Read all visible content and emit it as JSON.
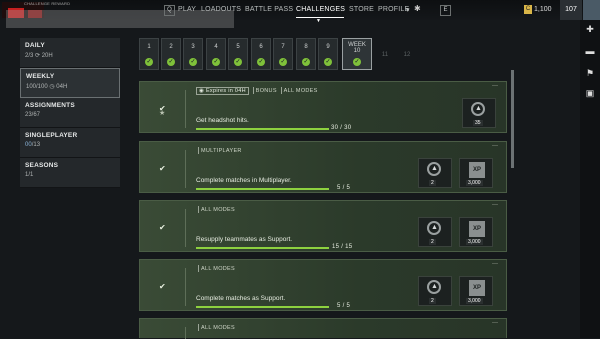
{
  "promo": {
    "text": "CHALLENGE REWARD"
  },
  "nav": {
    "kb_left": "Q",
    "items": [
      "PLAY",
      "LOADOUTS",
      "BATTLE PASS",
      "CHALLENGES",
      "STORE",
      "PROFILE"
    ],
    "profile_caret": "▾",
    "kb_right": "E",
    "currency": "1,100",
    "level": "107"
  },
  "categories": [
    {
      "title": "DAILY",
      "sub": "2/3",
      "time": "20H"
    },
    {
      "title": "WEEKLY",
      "sub": "100/100",
      "time": "04H"
    },
    {
      "title": "ASSIGNMENTS",
      "sub": "23/67"
    },
    {
      "title": "SINGLEPLAYER",
      "sub_hl": "00",
      "sub": "/13"
    },
    {
      "title": "SEASONS",
      "sub": "1/1"
    }
  ],
  "weeks": [
    {
      "label": "1"
    },
    {
      "label": "2"
    },
    {
      "label": "3"
    },
    {
      "label": "4"
    },
    {
      "label": "5"
    },
    {
      "label": "6"
    },
    {
      "label": "7"
    },
    {
      "label": "8"
    },
    {
      "label": "9"
    },
    {
      "label": "WEEK",
      "num": "10"
    },
    {
      "label": "11"
    },
    {
      "label": "12"
    }
  ],
  "challenges": [
    {
      "expires": "Expires in 04H",
      "tags": [
        "BONUS",
        "ALL MODES"
      ],
      "desc": "Get headshot hits.",
      "progress": "30 / 30",
      "progress_fraction": 1.0,
      "reward_count": "35"
    },
    {
      "tags": [
        "MULTIPLAYER"
      ],
      "desc": "Complete matches in Multiplayer.",
      "progress": "5 / 5",
      "progress_fraction": 1.0,
      "reward_count": "2",
      "xp_label": "XP",
      "xp": "3,000"
    },
    {
      "tags": [
        "ALL MODES"
      ],
      "desc": "Resupply teammates as Support.",
      "progress": "15 / 15",
      "progress_fraction": 1.0,
      "reward_count": "2",
      "xp_label": "XP",
      "xp": "3,000"
    },
    {
      "tags": [
        "ALL MODES"
      ],
      "desc": "Complete matches as Support.",
      "progress": "5 / 5",
      "progress_fraction": 1.0,
      "reward_count": "2",
      "xp_label": "XP",
      "xp": "3,000"
    },
    {
      "tags": [
        "ALL MODES"
      ]
    }
  ]
}
